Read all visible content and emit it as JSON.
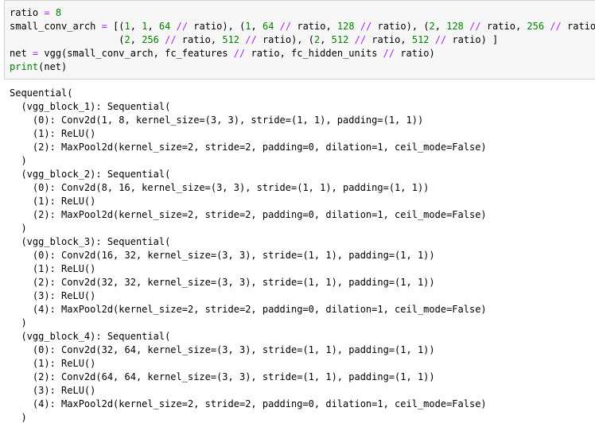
{
  "colors": {
    "variable": "#000000",
    "operator": "#aa22ff",
    "number": "#008000",
    "builtin": "#008000",
    "punct": "#000000",
    "output_text": "#000000",
    "cell_background": "#f7f7f7",
    "cell_border": "#cfcfcf"
  },
  "input_cell": {
    "lines": [
      [
        {
          "t": "ratio",
          "k": "variable"
        },
        {
          "t": " ",
          "k": "punct"
        },
        {
          "t": "=",
          "k": "operator"
        },
        {
          "t": " ",
          "k": "punct"
        },
        {
          "t": "8",
          "k": "number"
        }
      ],
      [
        {
          "t": "small_conv_arch",
          "k": "variable"
        },
        {
          "t": " ",
          "k": "punct"
        },
        {
          "t": "=",
          "k": "operator"
        },
        {
          "t": " [(",
          "k": "punct"
        },
        {
          "t": "1",
          "k": "number"
        },
        {
          "t": ", ",
          "k": "punct"
        },
        {
          "t": "1",
          "k": "number"
        },
        {
          "t": ", ",
          "k": "punct"
        },
        {
          "t": "64",
          "k": "number"
        },
        {
          "t": " ",
          "k": "punct"
        },
        {
          "t": "//",
          "k": "operator"
        },
        {
          "t": " ratio), (",
          "k": "punct"
        },
        {
          "t": "1",
          "k": "number"
        },
        {
          "t": ", ",
          "k": "punct"
        },
        {
          "t": "64",
          "k": "number"
        },
        {
          "t": " ",
          "k": "punct"
        },
        {
          "t": "//",
          "k": "operator"
        },
        {
          "t": " ratio, ",
          "k": "punct"
        },
        {
          "t": "128",
          "k": "number"
        },
        {
          "t": " ",
          "k": "punct"
        },
        {
          "t": "//",
          "k": "operator"
        },
        {
          "t": " ratio), (",
          "k": "punct"
        },
        {
          "t": "2",
          "k": "number"
        },
        {
          "t": ", ",
          "k": "punct"
        },
        {
          "t": "128",
          "k": "number"
        },
        {
          "t": " ",
          "k": "punct"
        },
        {
          "t": "//",
          "k": "operator"
        },
        {
          "t": " ratio, ",
          "k": "punct"
        },
        {
          "t": "256",
          "k": "number"
        },
        {
          "t": " ",
          "k": "punct"
        },
        {
          "t": "//",
          "k": "operator"
        },
        {
          "t": " ratio),",
          "k": "punct"
        }
      ],
      [
        {
          "t": "                   (",
          "k": "punct"
        },
        {
          "t": "2",
          "k": "number"
        },
        {
          "t": ", ",
          "k": "punct"
        },
        {
          "t": "256",
          "k": "number"
        },
        {
          "t": " ",
          "k": "punct"
        },
        {
          "t": "//",
          "k": "operator"
        },
        {
          "t": " ratio, ",
          "k": "punct"
        },
        {
          "t": "512",
          "k": "number"
        },
        {
          "t": " ",
          "k": "punct"
        },
        {
          "t": "//",
          "k": "operator"
        },
        {
          "t": " ratio), (",
          "k": "punct"
        },
        {
          "t": "2",
          "k": "number"
        },
        {
          "t": ", ",
          "k": "punct"
        },
        {
          "t": "512",
          "k": "number"
        },
        {
          "t": " ",
          "k": "punct"
        },
        {
          "t": "//",
          "k": "operator"
        },
        {
          "t": " ratio, ",
          "k": "punct"
        },
        {
          "t": "512",
          "k": "number"
        },
        {
          "t": " ",
          "k": "punct"
        },
        {
          "t": "//",
          "k": "operator"
        },
        {
          "t": " ratio) ]",
          "k": "punct"
        }
      ],
      [
        {
          "t": "net",
          "k": "variable"
        },
        {
          "t": " ",
          "k": "punct"
        },
        {
          "t": "=",
          "k": "operator"
        },
        {
          "t": " vgg(small_conv_arch, fc_features ",
          "k": "punct"
        },
        {
          "t": "//",
          "k": "operator"
        },
        {
          "t": " ratio, fc_hidden_units ",
          "k": "punct"
        },
        {
          "t": "//",
          "k": "operator"
        },
        {
          "t": " ratio)",
          "k": "punct"
        }
      ],
      [
        {
          "t": "print",
          "k": "builtin"
        },
        {
          "t": "(net)",
          "k": "punct"
        }
      ]
    ]
  },
  "output": {
    "lines": [
      "Sequential(",
      "  (vgg_block_1): Sequential(",
      "    (0): Conv2d(1, 8, kernel_size=(3, 3), stride=(1, 1), padding=(1, 1))",
      "    (1): ReLU()",
      "    (2): MaxPool2d(kernel_size=2, stride=2, padding=0, dilation=1, ceil_mode=False)",
      "  )",
      "  (vgg_block_2): Sequential(",
      "    (0): Conv2d(8, 16, kernel_size=(3, 3), stride=(1, 1), padding=(1, 1))",
      "    (1): ReLU()",
      "    (2): MaxPool2d(kernel_size=2, stride=2, padding=0, dilation=1, ceil_mode=False)",
      "  )",
      "  (vgg_block_3): Sequential(",
      "    (0): Conv2d(16, 32, kernel_size=(3, 3), stride=(1, 1), padding=(1, 1))",
      "    (1): ReLU()",
      "    (2): Conv2d(32, 32, kernel_size=(3, 3), stride=(1, 1), padding=(1, 1))",
      "    (3): ReLU()",
      "    (4): MaxPool2d(kernel_size=2, stride=2, padding=0, dilation=1, ceil_mode=False)",
      "  )",
      "  (vgg_block_4): Sequential(",
      "    (0): Conv2d(32, 64, kernel_size=(3, 3), stride=(1, 1), padding=(1, 1))",
      "    (1): ReLU()",
      "    (2): Conv2d(64, 64, kernel_size=(3, 3), stride=(1, 1), padding=(1, 1))",
      "    (3): ReLU()",
      "    (4): MaxPool2d(kernel_size=2, stride=2, padding=0, dilation=1, ceil_mode=False)",
      "  )"
    ]
  }
}
